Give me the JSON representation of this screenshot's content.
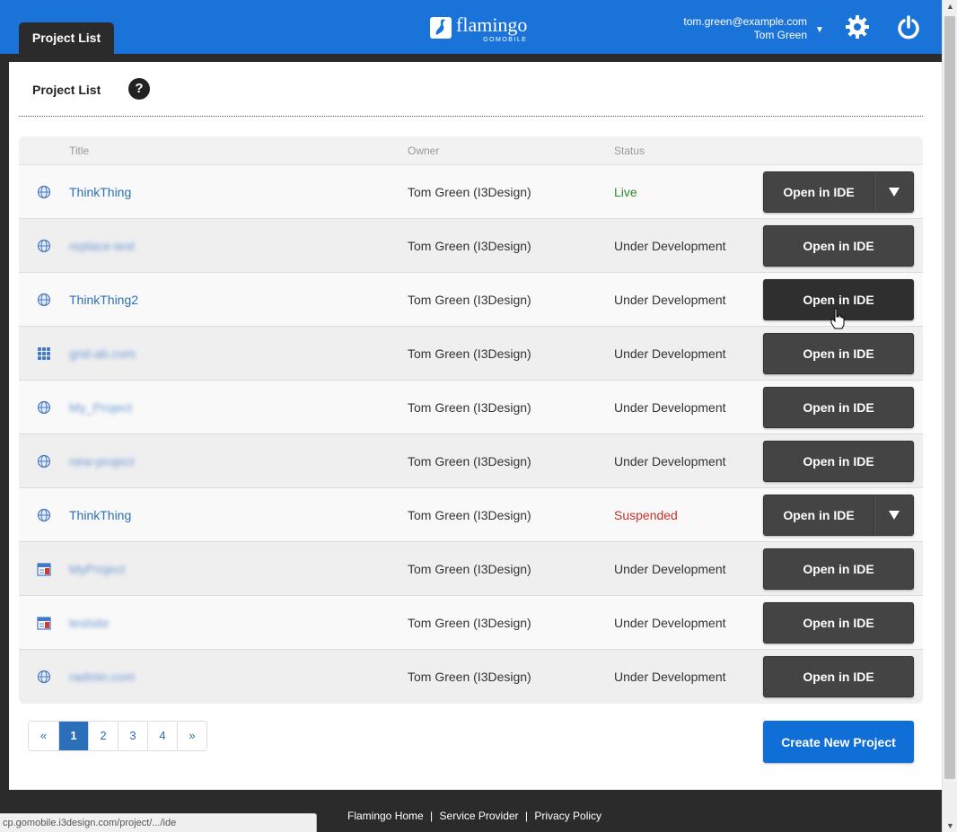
{
  "header": {
    "tab_label": "Project List",
    "logo_word": "flamingo",
    "logo_sub": "GOMOBILE",
    "user_email": "tom.green@example.com",
    "user_name": "Tom Green",
    "accent_color": "#1a73d9"
  },
  "page": {
    "title": "Project List",
    "help_label": "?"
  },
  "table": {
    "columns": [
      "Title",
      "Owner",
      "Status"
    ],
    "open_label": "Open in IDE",
    "rows": [
      {
        "icon": "globe-icon",
        "title": "ThinkThing",
        "blurred": false,
        "owner": "Tom Green (I3Design)",
        "status": "Live",
        "split": true
      },
      {
        "icon": "globe-icon",
        "title": "replace-test",
        "blurred": true,
        "owner": "Tom Green (I3Design)",
        "status": "Under Development",
        "split": false
      },
      {
        "icon": "globe-icon",
        "title": "ThinkThing2",
        "blurred": false,
        "owner": "Tom Green (I3Design)",
        "status": "Under Development",
        "split": false
      },
      {
        "icon": "grid-icon",
        "title": "grid-ab.com",
        "blurred": true,
        "owner": "Tom Green (I3Design)",
        "status": "Under Development",
        "split": false
      },
      {
        "icon": "globe-icon",
        "title": "My_Project",
        "blurred": true,
        "owner": "Tom Green (I3Design)",
        "status": "Under Development",
        "split": false
      },
      {
        "icon": "globe-icon",
        "title": "new-project",
        "blurred": true,
        "owner": "Tom Green (I3Design)",
        "status": "Under Development",
        "split": false
      },
      {
        "icon": "globe-icon",
        "title": "ThinkThing",
        "blurred": false,
        "owner": "Tom Green (I3Design)",
        "status": "Suspended",
        "split": true
      },
      {
        "icon": "calendar-icon",
        "title": "MyProject",
        "blurred": true,
        "owner": "Tom Green (I3Design)",
        "status": "Under Development",
        "split": false
      },
      {
        "icon": "calendar-icon",
        "title": "testsite",
        "blurred": true,
        "owner": "Tom Green (I3Design)",
        "status": "Under Development",
        "split": false
      },
      {
        "icon": "globe-icon",
        "title": "radmin.com",
        "blurred": true,
        "owner": "Tom Green (I3Design)",
        "status": "Under Development",
        "split": false
      }
    ]
  },
  "pagination": {
    "prev": "«",
    "pages": [
      "1",
      "2",
      "3",
      "4"
    ],
    "active": "1",
    "next": "»"
  },
  "create_button": "Create New Project",
  "footer": {
    "links": [
      "Flamingo Home",
      "Service Provider",
      "Privacy Policy"
    ],
    "separator": "|"
  },
  "status_url": "cp.gomobile.i3design.com/project/.../ide",
  "status_colors": {
    "live": "#2e8b2e",
    "suspended": "#c8312a"
  }
}
